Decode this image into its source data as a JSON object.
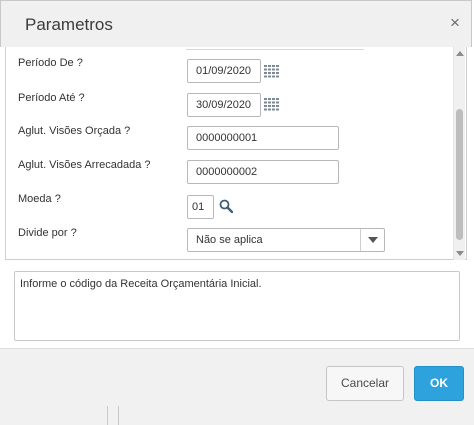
{
  "dialog": {
    "title": "Parametros",
    "close_glyph": "×",
    "close_icon": "close-icon"
  },
  "params": {
    "periodo_de": {
      "label": "Período De ?",
      "value": "01/09/2020",
      "icon": "calendar-icon"
    },
    "periodo_ate": {
      "label": "Período Até ?",
      "value": "30/09/2020",
      "icon": "calendar-icon"
    },
    "aglut_orcada": {
      "label": "Aglut. Visões Orçada ?",
      "value": "0000000001"
    },
    "aglut_arrecadada": {
      "label": "Aglut. Visões Arrecadada ?",
      "value": "0000000002"
    },
    "moeda": {
      "label": "Moeda ?",
      "value": "01",
      "icon": "search-icon"
    },
    "divide_por": {
      "label": "Divide por ?",
      "selected": "Não se aplica"
    }
  },
  "help": {
    "text": "Informe o código da Receita Orçamentária Inicial."
  },
  "footer": {
    "cancel_label": "Cancelar",
    "ok_label": "OK"
  },
  "colors": {
    "ok_button": "#2ea2dc",
    "titlebar": "#f0f0f0",
    "footer": "#f1f1f1"
  }
}
